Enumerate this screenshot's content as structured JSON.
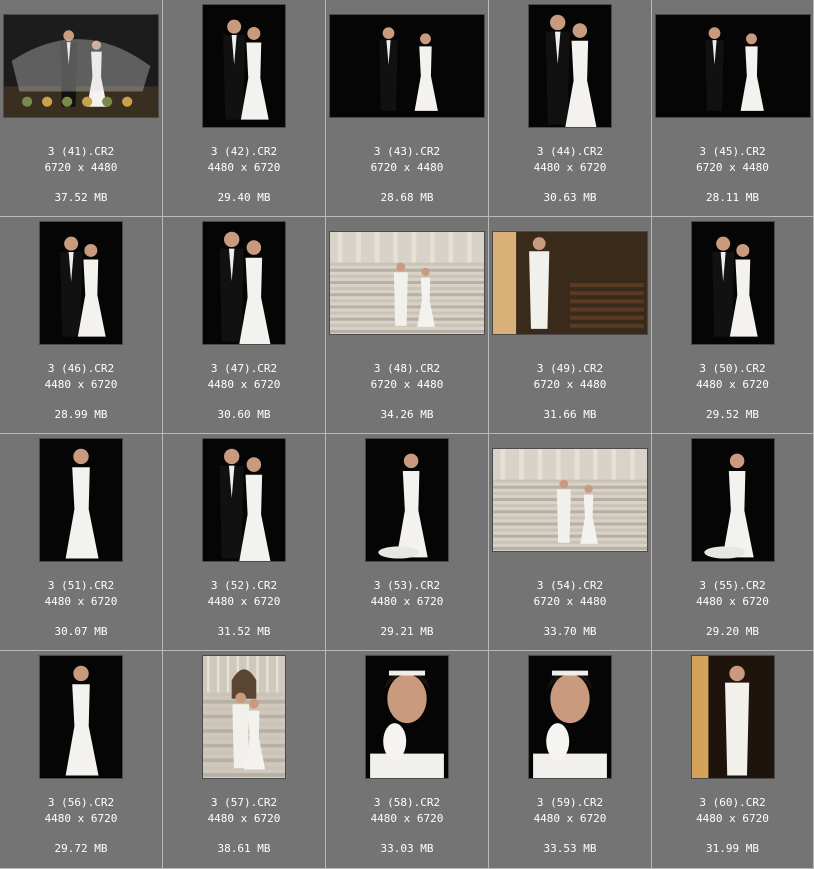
{
  "files": [
    {
      "name": "3 (41).CR2",
      "dims": "6720 x 4480",
      "size": "37.52 MB",
      "orientation": "landscape",
      "scene": "veil",
      "bg": "#1c1c1c"
    },
    {
      "name": "3 (42).CR2",
      "dims": "4480 x 6720",
      "size": "29.40 MB",
      "orientation": "portrait",
      "scene": "couple",
      "bg": "#050505"
    },
    {
      "name": "3 (43).CR2",
      "dims": "6720 x 4480",
      "size": "28.68 MB",
      "orientation": "landscape",
      "scene": "couple",
      "bg": "#050505"
    },
    {
      "name": "3 (44).CR2",
      "dims": "4480 x 6720",
      "size": "30.63 MB",
      "orientation": "portrait",
      "scene": "couple-close",
      "bg": "#050505"
    },
    {
      "name": "3 (45).CR2",
      "dims": "6720 x 4480",
      "size": "28.11 MB",
      "orientation": "landscape",
      "scene": "couple",
      "bg": "#050505"
    },
    {
      "name": "3 (46).CR2",
      "dims": "4480 x 6720",
      "size": "28.99 MB",
      "orientation": "portrait",
      "scene": "couple",
      "bg": "#050505"
    },
    {
      "name": "3 (47).CR2",
      "dims": "4480 x 6720",
      "size": "30.60 MB",
      "orientation": "portrait",
      "scene": "couple-close",
      "bg": "#050505"
    },
    {
      "name": "3 (48).CR2",
      "dims": "6720 x 4480",
      "size": "34.26 MB",
      "orientation": "landscape",
      "scene": "stairs",
      "bg": "#d8d2c8"
    },
    {
      "name": "3 (49).CR2",
      "dims": "6720 x 4480",
      "size": "31.66 MB",
      "orientation": "landscape",
      "scene": "church",
      "bg": "#3a2a1a"
    },
    {
      "name": "3 (50).CR2",
      "dims": "4480 x 6720",
      "size": "29.52 MB",
      "orientation": "portrait",
      "scene": "couple",
      "bg": "#050505"
    },
    {
      "name": "3 (51).CR2",
      "dims": "4480 x 6720",
      "size": "30.07 MB",
      "orientation": "portrait",
      "scene": "bride",
      "bg": "#050505"
    },
    {
      "name": "3 (52).CR2",
      "dims": "4480 x 6720",
      "size": "31.52 MB",
      "orientation": "portrait",
      "scene": "couple-close",
      "bg": "#050505"
    },
    {
      "name": "3 (53).CR2",
      "dims": "4480 x 6720",
      "size": "29.21 MB",
      "orientation": "portrait",
      "scene": "bride-gown",
      "bg": "#050505"
    },
    {
      "name": "3 (54).CR2",
      "dims": "6720 x 4480",
      "size": "33.70 MB",
      "orientation": "landscape",
      "scene": "stairs",
      "bg": "#d8d2c8"
    },
    {
      "name": "3 (55).CR2",
      "dims": "4480 x 6720",
      "size": "29.20 MB",
      "orientation": "portrait",
      "scene": "bride-gown",
      "bg": "#050505"
    },
    {
      "name": "3 (56).CR2",
      "dims": "4480 x 6720",
      "size": "29.72 MB",
      "orientation": "portrait",
      "scene": "bride",
      "bg": "#050505"
    },
    {
      "name": "3 (57).CR2",
      "dims": "4480 x 6720",
      "size": "38.61 MB",
      "orientation": "portrait",
      "scene": "stairs-tall",
      "bg": "#cfc8bc"
    },
    {
      "name": "3 (58).CR2",
      "dims": "4480 x 6720",
      "size": "33.03 MB",
      "orientation": "portrait",
      "scene": "portrait",
      "bg": "#050505"
    },
    {
      "name": "3 (59).CR2",
      "dims": "4480 x 6720",
      "size": "33.53 MB",
      "orientation": "portrait",
      "scene": "portrait",
      "bg": "#050505"
    },
    {
      "name": "3 (60).CR2",
      "dims": "4480 x 6720",
      "size": "31.99 MB",
      "orientation": "portrait",
      "scene": "groom-window",
      "bg": "#1e140c"
    }
  ],
  "colors": {
    "cell_bg": "#747474",
    "grid_line": "#b9b9b9",
    "caption_text": "#ffffff"
  }
}
